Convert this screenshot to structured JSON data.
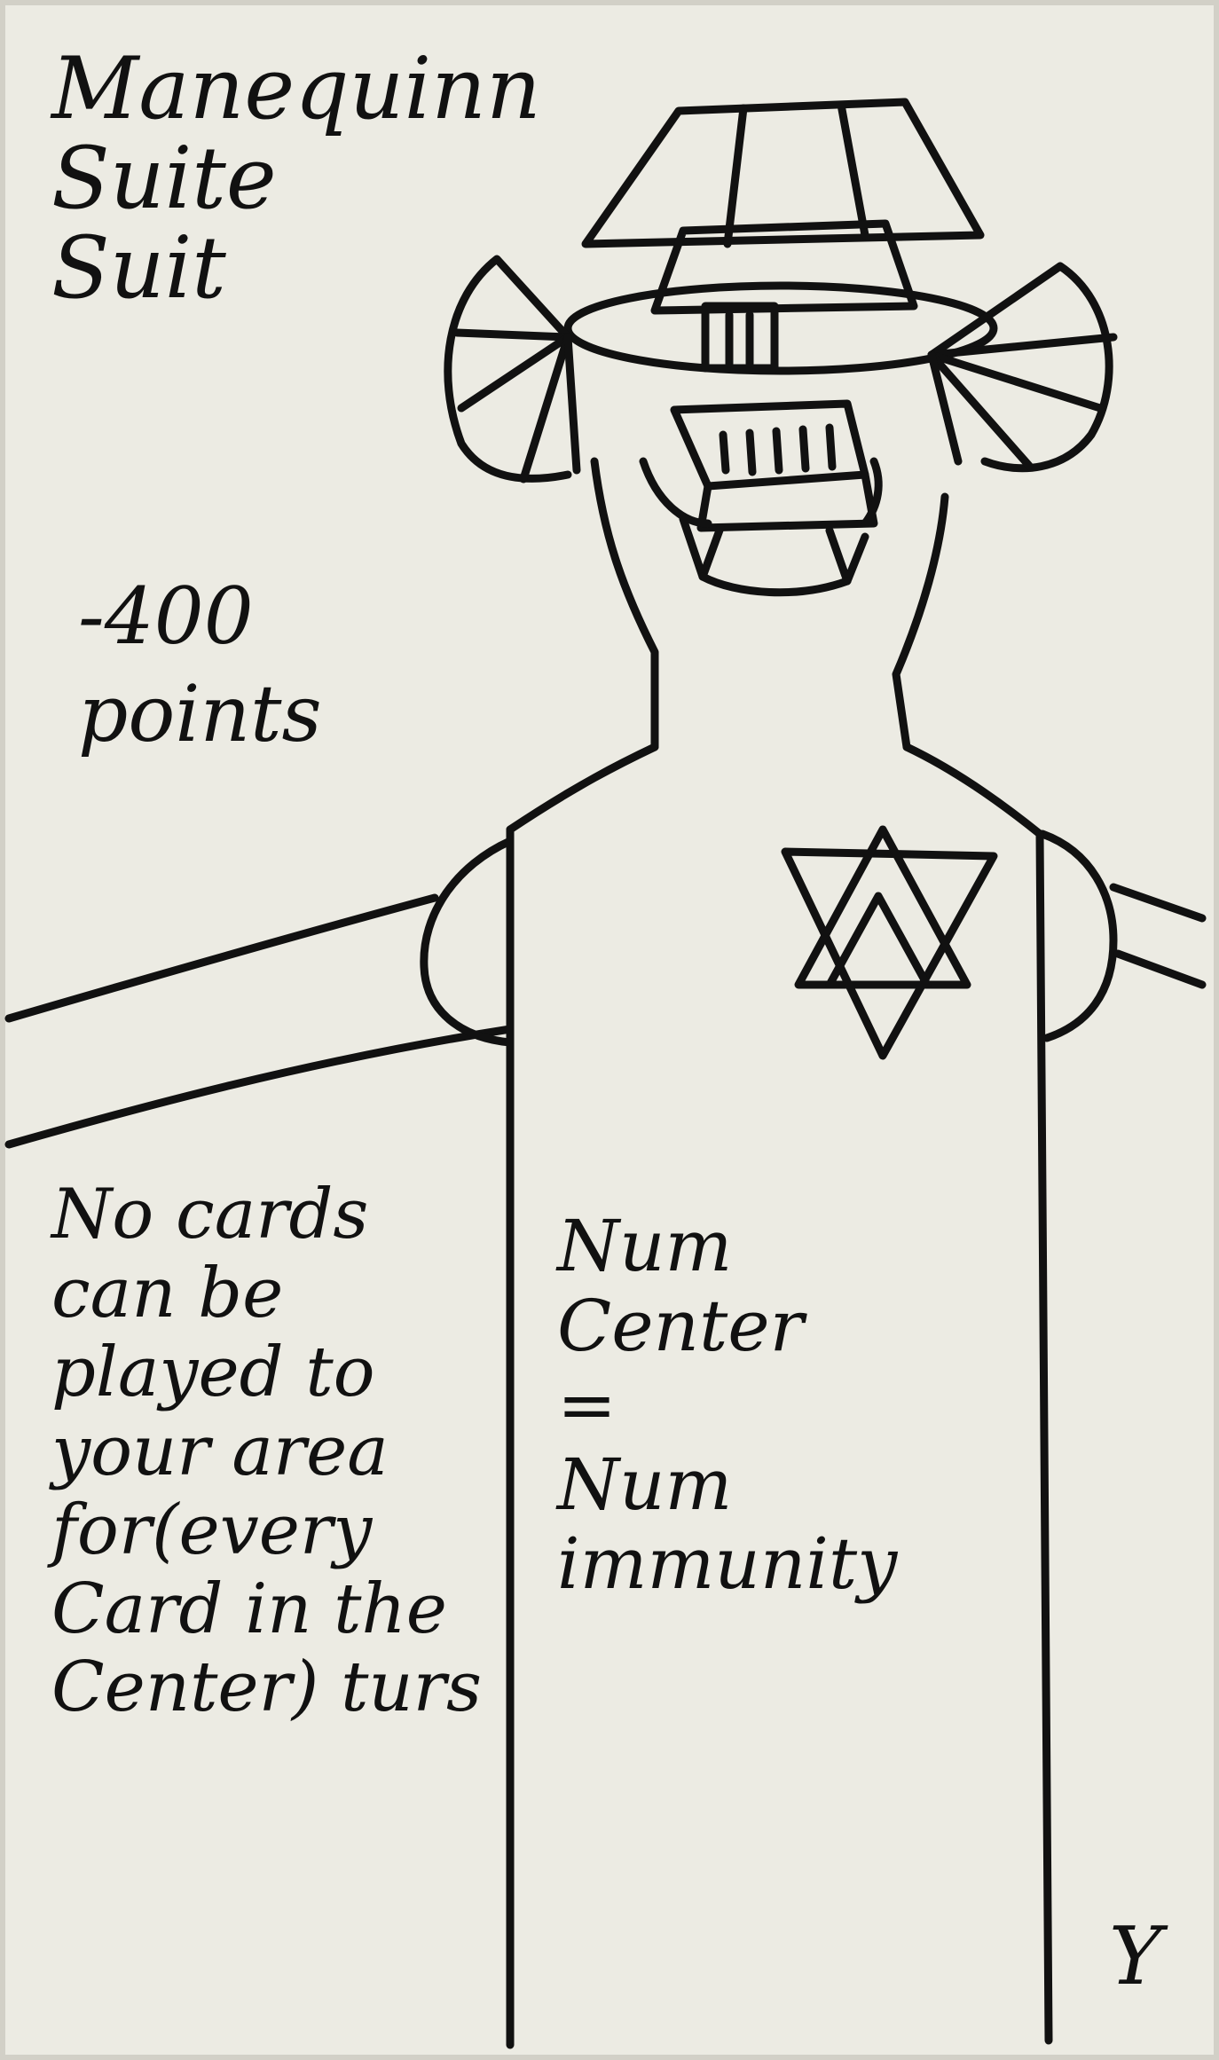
{
  "card": {
    "title": "Manequinn\nSuite\nSuit",
    "points": "-400\npoints",
    "rule_left": "No cards\ncan be\nplayed to\nyour area\nfor(every\nCard in the\nCenter) turs",
    "rule_right": "Num\nCenter\n=\nNum\nimmunity",
    "mark": "Υ"
  },
  "colors": {
    "paper": "#ecebe3",
    "ink": "#111111"
  },
  "icons": {
    "emblem": "star-of-david-icon"
  }
}
